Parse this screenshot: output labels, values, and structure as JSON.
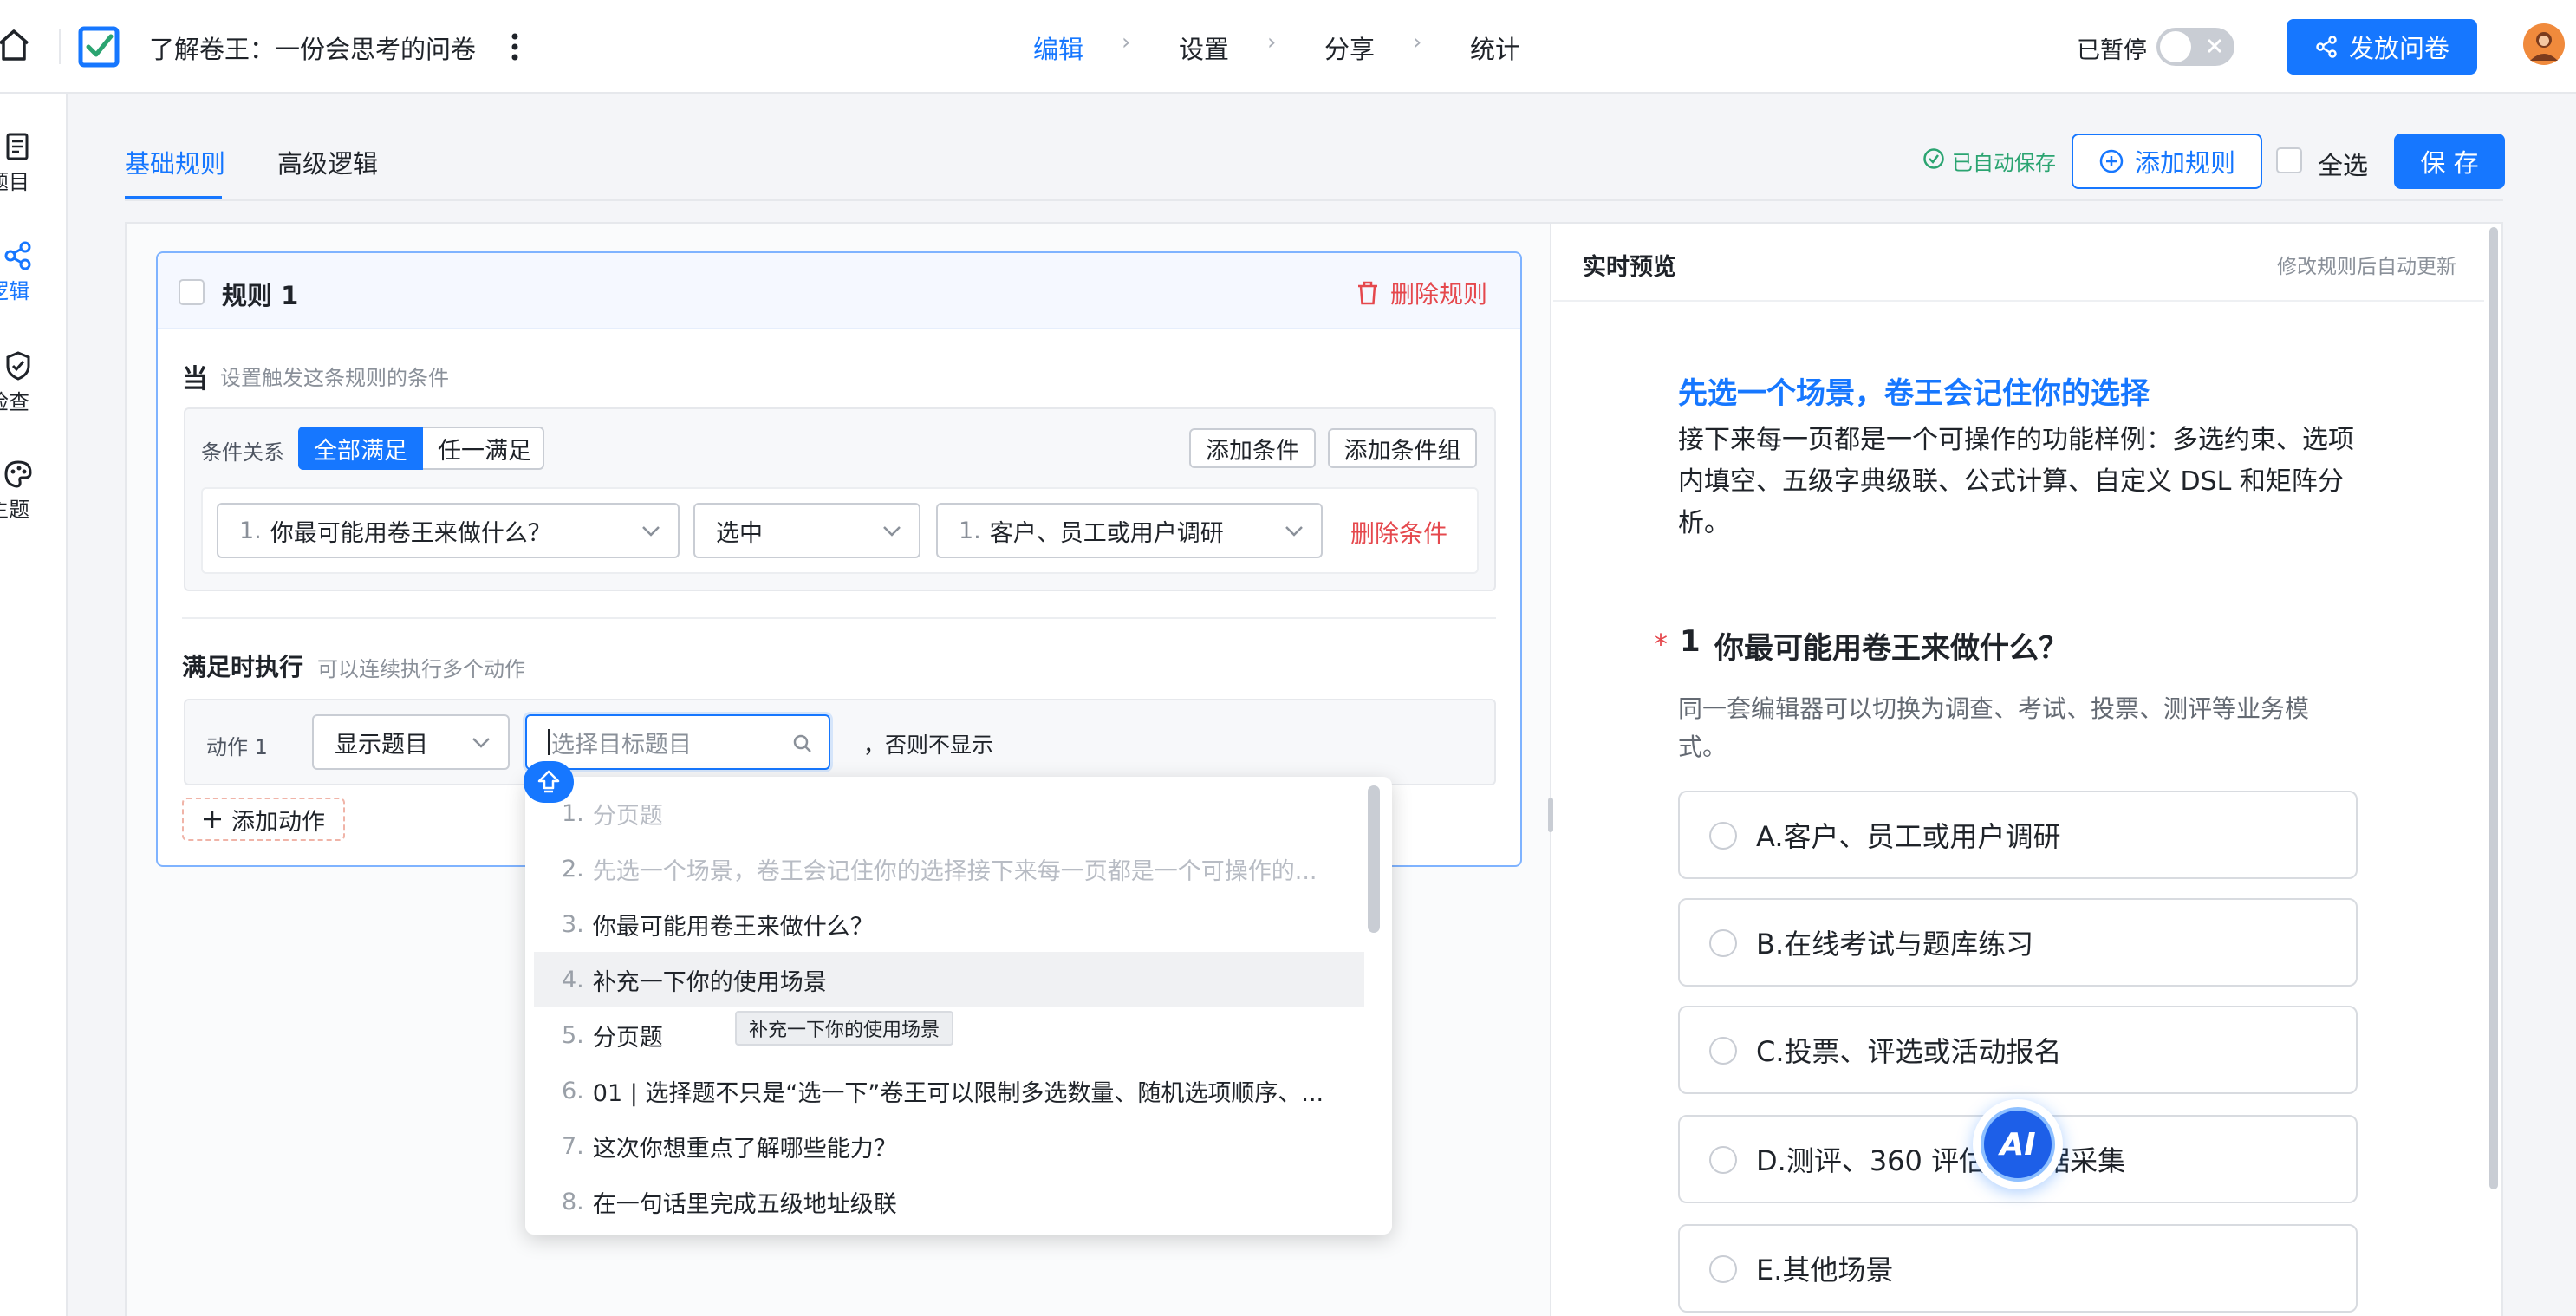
{
  "header": {
    "title": "了解卷王：一份会思考的问卷",
    "steps": [
      "编辑",
      "设置",
      "分享",
      "统计"
    ],
    "active_step": "编辑",
    "pause_label": "已暂停",
    "publish_label": "发放问卷"
  },
  "sidebar": {
    "items": [
      {
        "label": "题目",
        "icon": "document-icon"
      },
      {
        "label": "逻辑",
        "icon": "logic-icon"
      },
      {
        "label": "检查",
        "icon": "shield-check-icon"
      },
      {
        "label": "主题",
        "icon": "palette-icon"
      }
    ]
  },
  "tabs": {
    "items": [
      "基础规则",
      "高级逻辑"
    ],
    "active": "基础规则"
  },
  "toolbar": {
    "autosave": "已自动保存",
    "add_rule": "添加规则",
    "select_all": "全选",
    "save": "保 存"
  },
  "rule": {
    "title": "规则 1",
    "delete_label": "删除规则",
    "when_label": "当",
    "when_hint": "设置触发这条规则的条件",
    "relation_label": "条件关系",
    "relation_options": [
      "全部满足",
      "任一满足"
    ],
    "relation_selected": "全部满足",
    "add_condition": "添加条件",
    "add_condition_group": "添加条件组",
    "condition": {
      "question_num": "1.",
      "question": "你最可能用卷王来做什么？",
      "operator": "选中",
      "option_num": "1.",
      "option": "客户、员工或用户调研",
      "delete_label": "删除条件"
    },
    "then_label": "满足时执行",
    "then_hint": "可以连续执行多个动作",
    "action": {
      "label": "动作 1",
      "type": "显示题目",
      "target_placeholder": "选择目标题目",
      "suffix": "，否则不显示"
    },
    "add_action": "添加动作"
  },
  "dropdown": {
    "items": [
      {
        "num": "1.",
        "text": "分页题",
        "disabled": true
      },
      {
        "num": "2.",
        "text": "先选一个场景，卷王会记住你的选择接下来每一页都是一个可操作的...",
        "disabled": true
      },
      {
        "num": "3.",
        "text": "你最可能用卷王来做什么？",
        "disabled": false
      },
      {
        "num": "4.",
        "text": "补充一下你的使用场景",
        "disabled": false,
        "hover": true
      },
      {
        "num": "5.",
        "text": "分页题",
        "disabled": false
      },
      {
        "num": "6.",
        "text": "01 | 选择题不只是“选一下”卷王可以限制多选数量、随机选项顺序、...",
        "disabled": false
      },
      {
        "num": "7.",
        "text": "这次你想重点了解哪些能力？",
        "disabled": false
      },
      {
        "num": "8.",
        "text": "在一句话里完成五级地址级联",
        "disabled": false
      }
    ],
    "tooltip": "补充一下你的使用场景"
  },
  "preview": {
    "title": "实时预览",
    "hint": "修改规则后自动更新",
    "heading": "先选一个场景，卷王会记住你的选择",
    "intro": "接下来每一页都是一个可操作的功能样例：多选约束、选项内填空、五级字典级联、公式计算、自定义 DSL 和矩阵分析。",
    "question": {
      "required_mark": "*",
      "number": "1",
      "text": "你最可能用卷王来做什么？",
      "desc": "同一套编辑器可以切换为调查、考试、投票、测评等业务模式。",
      "options": [
        "A.客户、员工或用户调研",
        "B.在线考试与题库练习",
        "C.投票、评选或活动报名",
        "D.测评、360 评估或数据采集",
        "E.其他场景"
      ]
    },
    "ai_badge": "AI"
  },
  "colors": {
    "primary": "#1677ff",
    "danger": "#e5484d",
    "success": "#2ba471"
  }
}
